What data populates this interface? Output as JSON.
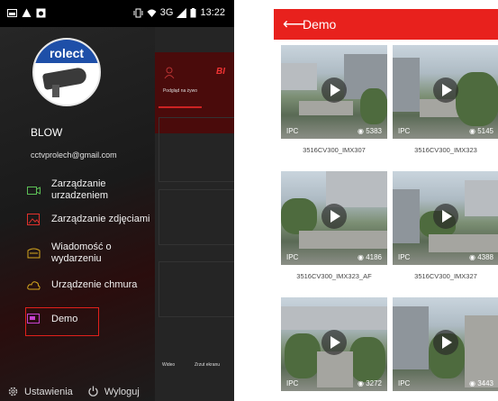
{
  "status_bar": {
    "network": "3G",
    "time": "13:22"
  },
  "drawer": {
    "user_name": "BLOW",
    "user_email": "cctvprolech@gmail.com",
    "avatar_brand": "rolect",
    "items": [
      {
        "label": "Zarządzanie urzadzeniem",
        "icon": "camera-icon"
      },
      {
        "label": "Zarządzanie zdjęciami",
        "icon": "image-icon"
      },
      {
        "label": "Wiadomość o wydarzeniu",
        "icon": "message-icon"
      },
      {
        "label": "Urządzenie chmura",
        "icon": "cloud-icon"
      },
      {
        "label": "Demo",
        "icon": "demo-icon"
      }
    ],
    "footer": {
      "settings": "Ustawienia",
      "logout": "Wyloguj"
    },
    "highlight_color": "#e0201b"
  },
  "background_app": {
    "brand": "BI",
    "tab_label": "Podgląd na żywo",
    "video_label": "Wideo",
    "screenshot_label": "Zrzut ekranu"
  },
  "demo_page": {
    "title": "Demo",
    "accent_color": "#e8211d",
    "videos": [
      {
        "name": "3516CV300_IMX307",
        "tag": "IPC",
        "views": "5383"
      },
      {
        "name": "3516CV300_IMX323",
        "tag": "IPC",
        "views": "5145"
      },
      {
        "name": "3516CV300_IMX323_AF",
        "tag": "IPC",
        "views": "4186"
      },
      {
        "name": "3516CV300_IMX327",
        "tag": "IPC",
        "views": "4388"
      },
      {
        "name": "",
        "tag": "IPC",
        "views": "3272"
      },
      {
        "name": "",
        "tag": "IPC",
        "views": "3443"
      }
    ]
  }
}
